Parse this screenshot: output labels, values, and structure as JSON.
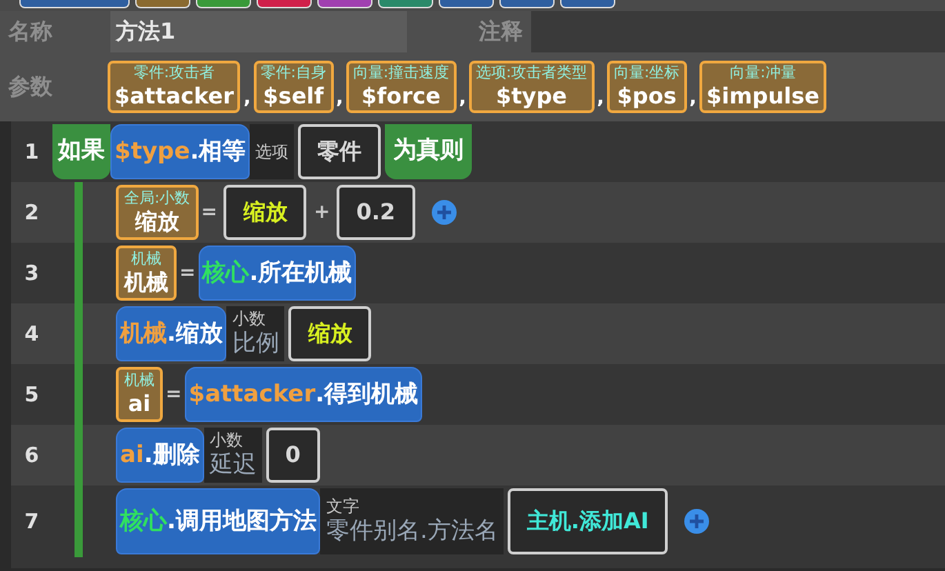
{
  "palette": [
    {
      "color": "#2f5fa0"
    },
    {
      "color": "#8a6a30"
    },
    {
      "color": "#3a9a3a"
    },
    {
      "color": "#d0204a"
    },
    {
      "color": "#a040b0"
    },
    {
      "color": "#2a8a6a"
    },
    {
      "color": "#2f5fa0"
    },
    {
      "color": "#2f5fa0"
    },
    {
      "color": "#2f5fa0"
    }
  ],
  "name_label": "名称",
  "name_value": "方法1",
  "comment_label": "注释",
  "params_label": "参数",
  "params": [
    {
      "type": "零件:攻击者",
      "name": "$attacker"
    },
    {
      "type": "零件:自身",
      "name": "$self"
    },
    {
      "type": "向量:撞击速度",
      "name": "$force"
    },
    {
      "type": "选项:攻击者类型",
      "name": "$type"
    },
    {
      "type": "向量:坐标",
      "name": "$pos"
    },
    {
      "type": "向量:冲量",
      "name": "$impulse"
    }
  ],
  "separator": ",",
  "rows": [
    {
      "number": "1",
      "kind": "if",
      "keyword": "如果",
      "suffix": "为真则",
      "parts": [
        {
          "kind": "call",
          "subject": "$type",
          "color": "#f0a040",
          "method": ".相等"
        },
        {
          "kind": "param",
          "type": "选项"
        },
        {
          "kind": "literal",
          "value": "零件",
          "color": "#d8d8d8"
        }
      ]
    },
    {
      "number": "2",
      "kind": "stmt",
      "parts": [
        {
          "kind": "var",
          "type": "全局:小数",
          "name": "缩放"
        },
        {
          "kind": "op",
          "value": "="
        },
        {
          "kind": "literal",
          "value": "缩放",
          "color": "#d8f020"
        },
        {
          "kind": "op",
          "value": "+"
        },
        {
          "kind": "literal",
          "value": "0.2",
          "color": "#d8d8d8"
        },
        {
          "kind": "add"
        }
      ]
    },
    {
      "number": "3",
      "kind": "stmt",
      "parts": [
        {
          "kind": "var",
          "type": "机械",
          "name": "机械"
        },
        {
          "kind": "op",
          "value": "="
        },
        {
          "kind": "call",
          "subject": "核心",
          "color": "#30e060",
          "method": ".所在机械"
        }
      ]
    },
    {
      "number": "4",
      "kind": "stmt",
      "parts": [
        {
          "kind": "call",
          "subject": "机械",
          "color": "#f0a040",
          "method": ".缩放"
        },
        {
          "kind": "param",
          "type": "小数",
          "name": "比例"
        },
        {
          "kind": "literal",
          "value": "缩放",
          "color": "#d8f020"
        }
      ]
    },
    {
      "number": "5",
      "kind": "stmt",
      "parts": [
        {
          "kind": "var",
          "type": "机械",
          "name": "ai"
        },
        {
          "kind": "op",
          "value": "="
        },
        {
          "kind": "call",
          "subject": "$attacker",
          "color": "#f0a040",
          "method": ".得到机械"
        }
      ]
    },
    {
      "number": "6",
      "kind": "stmt",
      "parts": [
        {
          "kind": "call",
          "subject": "ai",
          "color": "#f0a040",
          "method": ".删除"
        },
        {
          "kind": "param",
          "type": "小数",
          "name": "延迟"
        },
        {
          "kind": "literal",
          "value": "0",
          "color": "#d8d8d8"
        }
      ]
    },
    {
      "number": "7",
      "kind": "stmt",
      "parts": [
        {
          "kind": "call",
          "subject": "核心",
          "color": "#30e060",
          "method": ".调用地图方法"
        },
        {
          "kind": "param",
          "type": "文字",
          "name": "零件别名.方法名"
        },
        {
          "kind": "literal",
          "value": "主机.添加AI",
          "color": "#40e8d8"
        },
        {
          "kind": "add"
        }
      ]
    }
  ]
}
